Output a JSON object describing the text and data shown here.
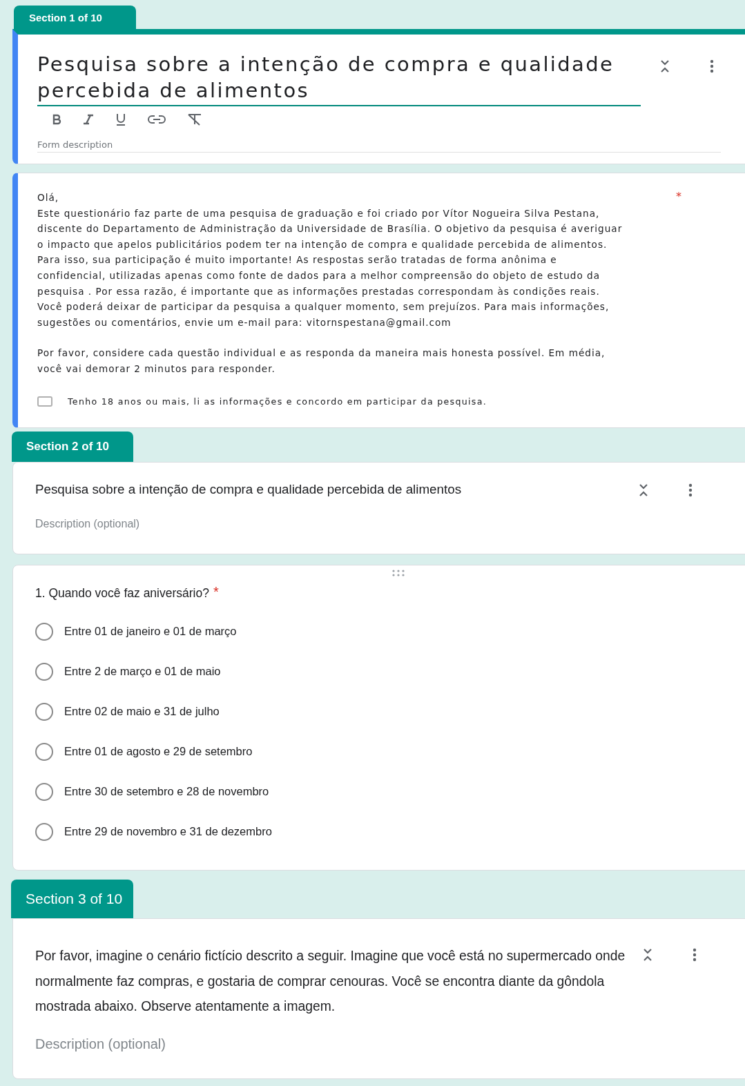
{
  "section1": {
    "tab": "Section 1 of 10",
    "title": "Pesquisa sobre a intenção de compra e qualidade\npercebida de alimentos",
    "description_placeholder": "Form description"
  },
  "intro": {
    "paragraphs": [
      "Olá,\nEste questionário faz parte de uma pesquisa de graduação e foi criado por Vítor Nogueira Silva Pestana,\ndiscente do Departamento de Administração da Universidade de Brasília. O objetivo da pesquisa é averiguar\no impacto que apelos publicitários podem ter na intenção de compra e qualidade percebida de alimentos.\nPara isso, sua participação é muito importante! As respostas serão tratadas de forma anônima e\nconfidencial, utilizadas apenas como fonte de dados para a melhor compreensão do objeto de estudo da\npesquisa . Por essa razão, é importante que as informações prestadas correspondam às condições reais.\nVocê poderá deixar de participar da pesquisa a qualquer momento, sem prejuízos. Para mais informações,\nsugestões ou comentários, envie um e-mail para: vitornspestana@gmail.com",
      "Por favor, considere cada questão individual e as responda da maneira mais honesta possível. Em média,\nvocê vai demorar 2 minutos para responder."
    ],
    "required": true,
    "required_mark": "*",
    "checkbox": {
      "label": "Tenho 18 anos ou mais, li as informações e concordo em participar da pesquisa.",
      "checked": false
    }
  },
  "section2": {
    "tab": "Section 2 of 10",
    "title": "Pesquisa sobre a intenção de compra e qualidade percebida de alimentos",
    "description_placeholder": "Description (optional)"
  },
  "question": {
    "title": "1. Quando você faz aniversário?",
    "required": true,
    "required_mark": "*",
    "options": [
      {
        "label": "Entre 01 de janeiro e 01 de março",
        "selected": false
      },
      {
        "label": "Entre 2 de março e 01 de maio",
        "selected": false
      },
      {
        "label": "Entre 02 de maio e 31 de julho",
        "selected": false
      },
      {
        "label": "Entre 01 de agosto e 29 de setembro",
        "selected": false
      },
      {
        "label": "Entre 30 de setembro e 28 de novembro",
        "selected": false
      },
      {
        "label": "Entre 29 de novembro e 31 de dezembro",
        "selected": false
      }
    ]
  },
  "section3": {
    "tab": "Section 3 of 10",
    "title": "Por favor, imagine o cenário fictício descrito a seguir. Imagine que você está no supermercado onde\nnormalmente faz compras, e gostaria de comprar cenouras. Você se encontra diante da gôndola\nmostrada abaixo. Observe atentamente a imagem.",
    "description_placeholder": "Description (optional)"
  }
}
